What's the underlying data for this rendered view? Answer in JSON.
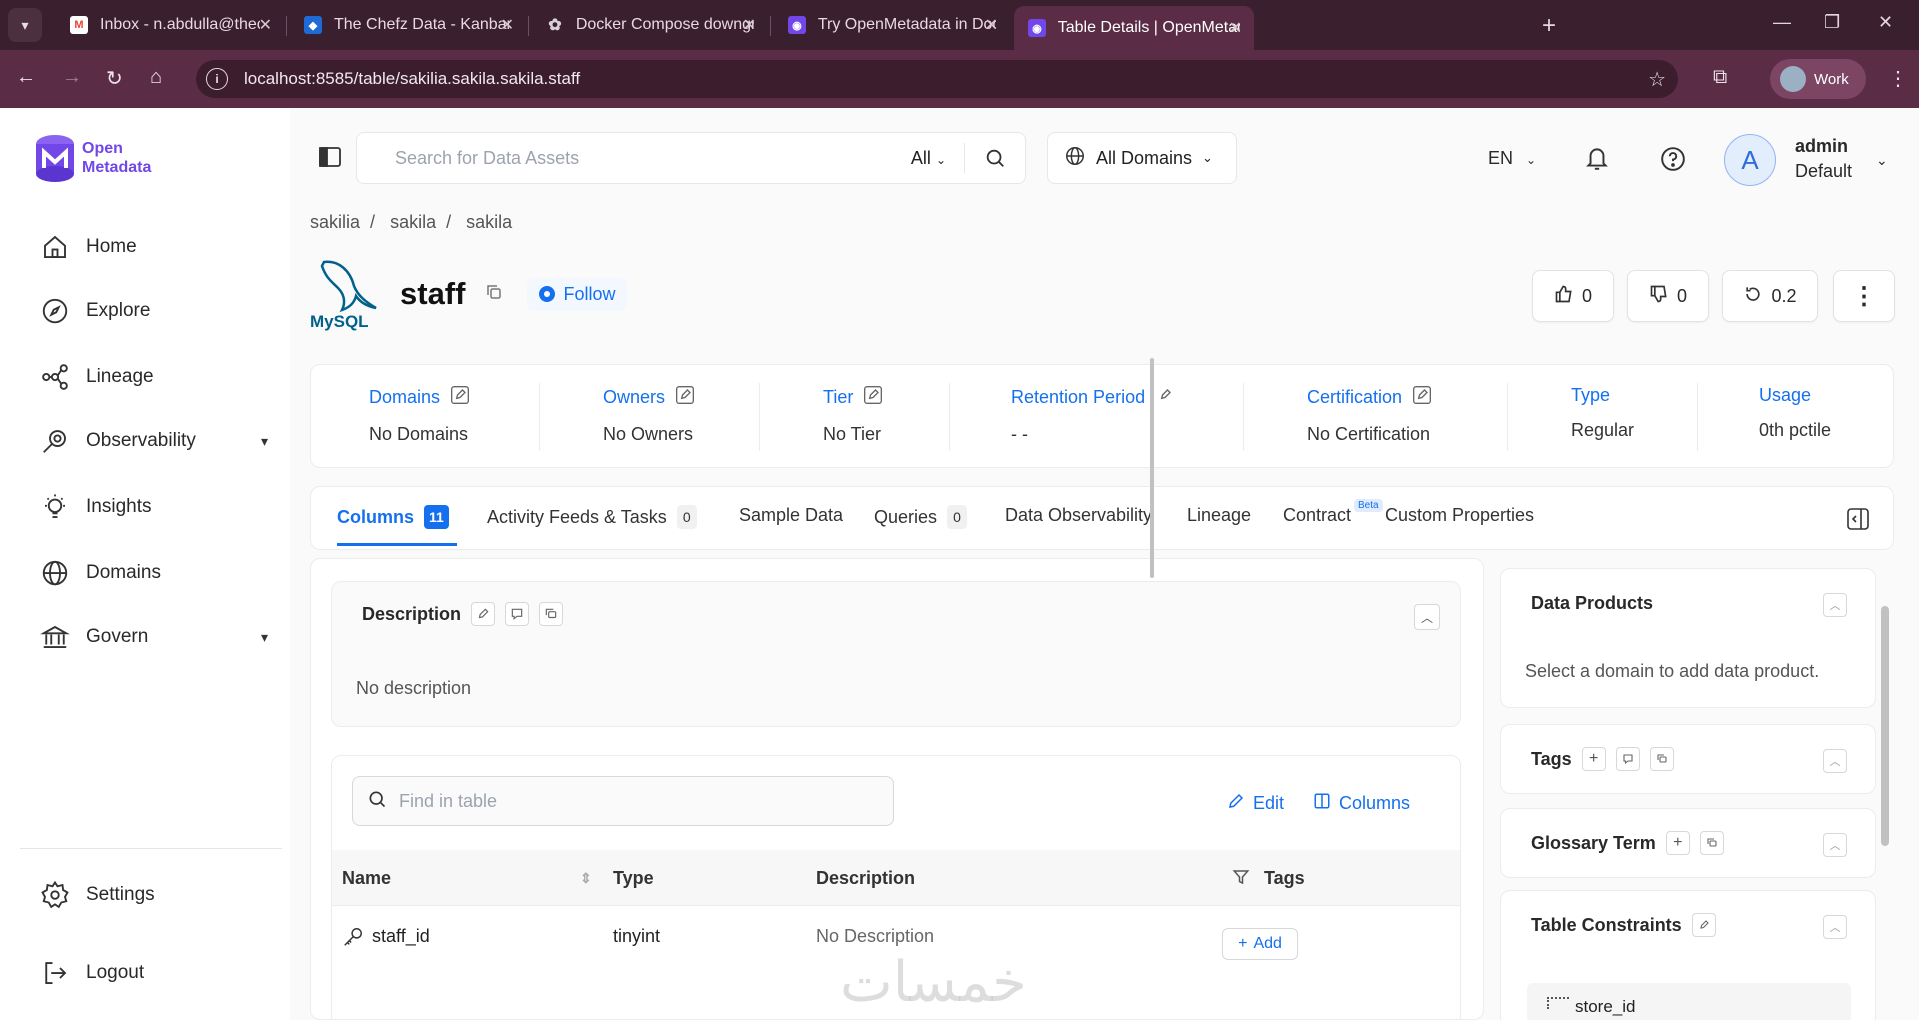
{
  "browser": {
    "tabs": [
      {
        "title": "Inbox - n.abdulla@thechefz.co",
        "icon": "gmail-icon",
        "color": "#ea4335"
      },
      {
        "title": "The Chefz Data - Kanban Board",
        "icon": "kanban-icon",
        "color": "#1e6bd6"
      },
      {
        "title": "Docker Compose downgrade",
        "icon": "chatgpt-icon",
        "color": "#d8d0d4"
      },
      {
        "title": "Try OpenMetadata in Docker",
        "icon": "openmetadata-icon",
        "color": "#7147e8"
      },
      {
        "title": "Table Details | OpenMetadata",
        "icon": "openmetadata-icon",
        "color": "#7147e8"
      }
    ],
    "url": "localhost:8585/table/sakilia.sakila.sakila.staff",
    "profile_label": "Work"
  },
  "logo": {
    "line1": "Open",
    "line2": "Metadata"
  },
  "sidebar": {
    "items": [
      {
        "label": "Home"
      },
      {
        "label": "Explore"
      },
      {
        "label": "Lineage"
      },
      {
        "label": "Observability"
      },
      {
        "label": "Insights"
      },
      {
        "label": "Domains"
      },
      {
        "label": "Govern"
      }
    ],
    "bottom": [
      {
        "label": "Settings"
      },
      {
        "label": "Logout"
      }
    ]
  },
  "topbar": {
    "search_placeholder": "Search for Data Assets",
    "search_scope": "All",
    "domains_label": "All Domains",
    "language": "EN",
    "avatar_letter": "A",
    "user_name": "admin",
    "user_role": "Default"
  },
  "breadcrumb": [
    "sakilia",
    "sakila",
    "sakila"
  ],
  "entity": {
    "service_logo_text": "MySQL",
    "name": "staff",
    "follow_label": "Follow",
    "upvotes": "0",
    "downvotes": "0",
    "version": "0.2"
  },
  "metadata": [
    {
      "label": "Domains",
      "value": "No Domains",
      "editable": true
    },
    {
      "label": "Owners",
      "value": "No Owners",
      "editable": true
    },
    {
      "label": "Tier",
      "value": "No Tier",
      "editable": true
    },
    {
      "label": "Retention Period",
      "value": "- -",
      "editable": true
    },
    {
      "label": "Certification",
      "value": "No Certification",
      "editable": true
    },
    {
      "label": "Type",
      "value": "Regular",
      "editable": false
    },
    {
      "label": "Usage",
      "value": "0th pctile",
      "editable": false
    }
  ],
  "tabs": [
    {
      "label": "Columns",
      "count": "11"
    },
    {
      "label": "Activity Feeds & Tasks",
      "count": "0"
    },
    {
      "label": "Sample Data"
    },
    {
      "label": "Queries",
      "count": "0"
    },
    {
      "label": "Data Observability"
    },
    {
      "label": "Lineage"
    },
    {
      "label": "Contract",
      "badge": "Beta"
    },
    {
      "label": "Custom Properties"
    }
  ],
  "description": {
    "title": "Description",
    "text": "No description"
  },
  "table": {
    "find_placeholder": "Find in table",
    "edit_label": "Edit",
    "columns_label": "Columns",
    "headers": [
      "Name",
      "Type",
      "Description",
      "Tags"
    ],
    "rows": [
      {
        "name": "staff_id",
        "type": "tinyint",
        "description": "No Description",
        "add_label": "Add"
      }
    ]
  },
  "right_panel": {
    "data_products_title": "Data Products",
    "data_products_text": "Select a domain to add data product.",
    "tags_title": "Tags",
    "glossary_title": "Glossary Term",
    "constraints_title": "Table Constraints",
    "constraint_item": "store_id"
  },
  "watermark": "خمسات",
  "colors": {
    "accent": "#1570ef",
    "brand": "#7147e8",
    "browser_frame": "#5a2c46"
  }
}
